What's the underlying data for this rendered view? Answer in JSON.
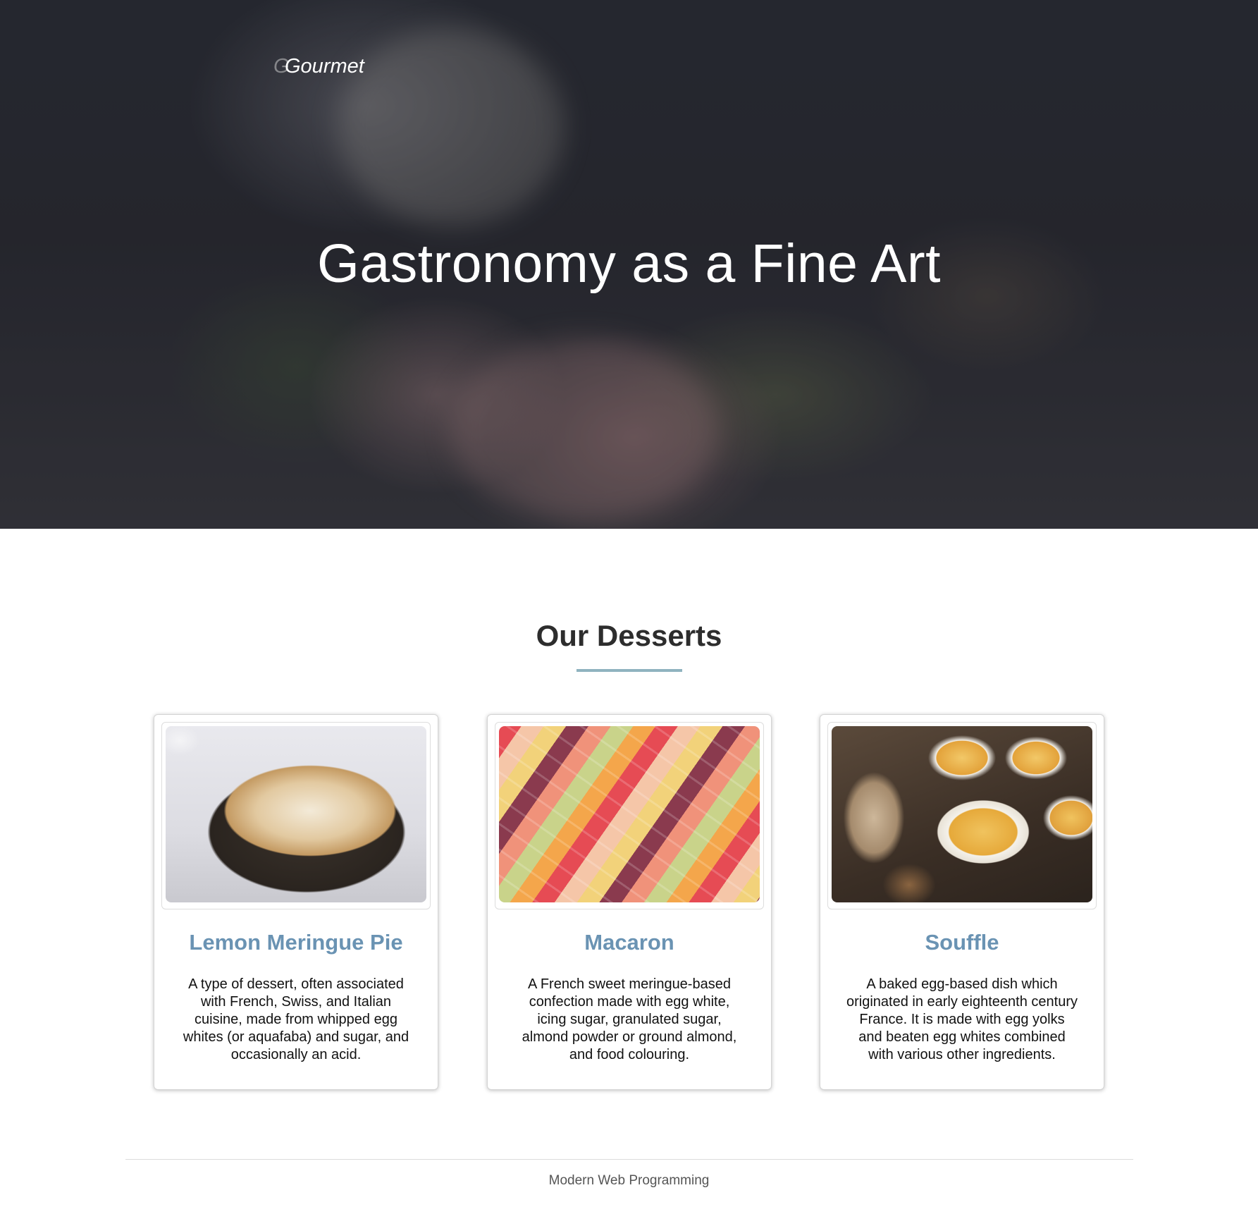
{
  "header": {
    "brand": "Gourmet",
    "brand_mark": "G",
    "hero_title": "Gastronomy as a Fine Art"
  },
  "desserts": {
    "section_title": "Our Desserts",
    "items": [
      {
        "title": "Lemon Meringue Pie",
        "description": "A type of dessert, often associated with French, Swiss, and Italian cuisine, made from whipped egg whites (or aquafaba) and sugar, and occasionally an acid."
      },
      {
        "title": "Macaron",
        "description": "A French sweet meringue-based confection made with egg white, icing sugar, granulated sugar, almond powder or ground almond, and food colouring."
      },
      {
        "title": "Souffle",
        "description": "A baked egg-based dish which originated in early eighteenth century France. It is made with egg yolks and beaten egg whites combined with various other ingredients."
      }
    ]
  },
  "footer": {
    "text": "Modern Web Programming"
  },
  "colors": {
    "accent": "#6a93b3",
    "underline": "#8fb3bf"
  }
}
